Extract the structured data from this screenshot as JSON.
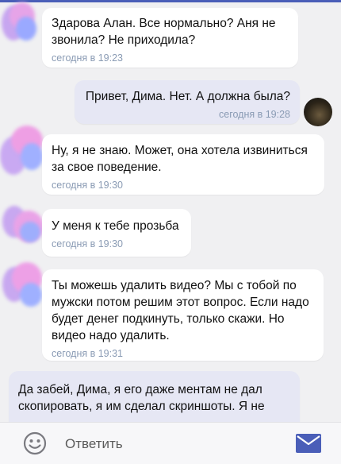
{
  "colors": {
    "accent": "#4a5eb8",
    "incoming_bubble": "#ffffff",
    "outgoing_bubble": "#e6e7f4",
    "time": "#8a9bb4",
    "background": "#f0f0f2"
  },
  "messages": [
    {
      "direction": "in",
      "text": "Здарова Алан. Все нормально? Аня не\nзвонила? Не приходила?",
      "time": "сегодня в 19:23"
    },
    {
      "direction": "out",
      "text": "Привет, Дима. Нет. А должна была?",
      "time": "сегодня в 19:28"
    },
    {
      "direction": "in",
      "text": "Ну, я не знаю. Может, она хотела извиниться\nза свое поведение.",
      "time": "сегодня в 19:30"
    },
    {
      "direction": "in",
      "text": "У меня к тебе прозьба",
      "time": "сегодня в 19:30"
    },
    {
      "direction": "in",
      "text": "Ты можешь удалить видео? Мы с тобой по\nмужски потом решим этот вопрос. Если надо\nбудет денег подкинуть, только скажи. Но\nвидео надо удалить.",
      "time": "сегодня в 19:31"
    },
    {
      "direction": "out",
      "text": "Да забей, Дима, я его даже ментам не дал\nскопировать, я им сделал скриншоты. Я не",
      "time": ""
    }
  ],
  "composer": {
    "emoji_icon": "smile-icon",
    "placeholder": "Ответить",
    "send_icon": "envelope-icon"
  }
}
